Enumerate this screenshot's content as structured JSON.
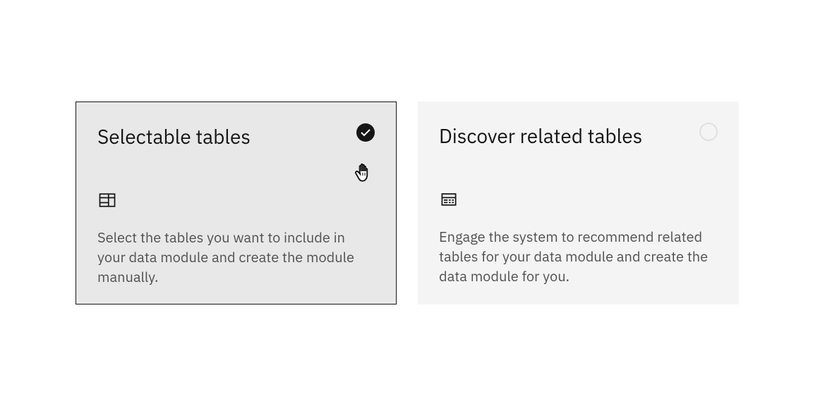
{
  "cards": {
    "selectable": {
      "title": "Selectable tables",
      "description": "Select the tables you want to include in your data module and create the module manually.",
      "selected": true
    },
    "discover": {
      "title": "Discover related tables",
      "description": "Engage the system to recommend related tables for your data module and create the data module for you.",
      "selected": false
    }
  }
}
